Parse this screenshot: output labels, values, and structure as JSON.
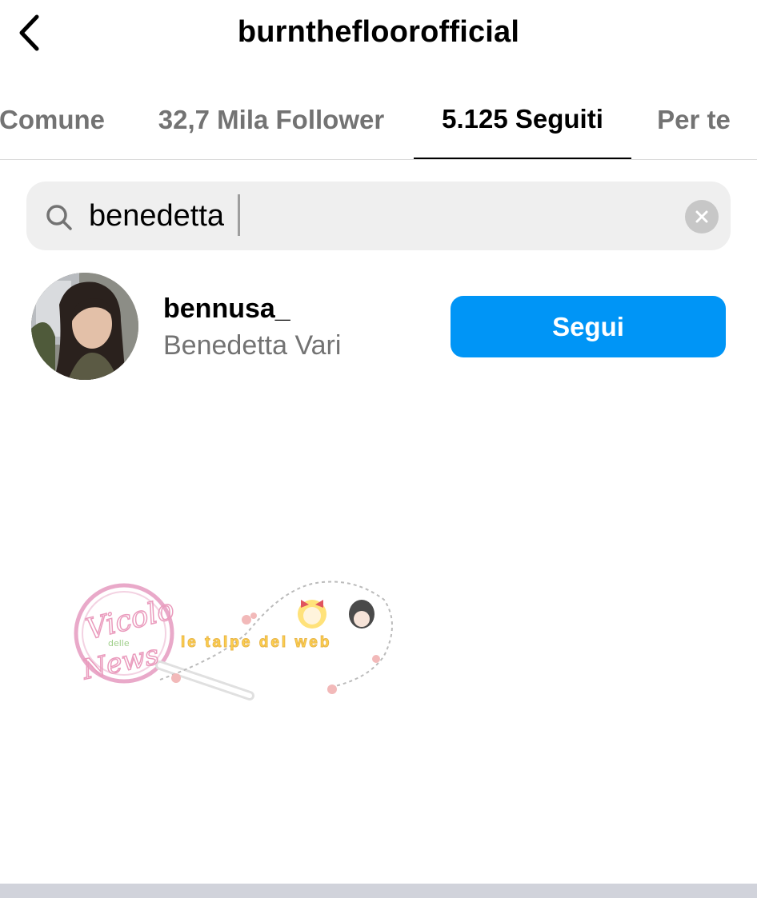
{
  "header": {
    "title": "burnthefloorofficial",
    "back_icon": "chevron-left-icon"
  },
  "tabs": [
    {
      "label": "Comune",
      "active": false
    },
    {
      "label": "32,7 Mila Follower",
      "active": false
    },
    {
      "label": "5.125 Seguiti",
      "active": true
    },
    {
      "label": "Per te",
      "active": false
    }
  ],
  "search": {
    "value": "benedetta",
    "icon": "search-icon",
    "clear_icon": "clear-icon"
  },
  "results": [
    {
      "username": "bennusa_",
      "full_name": "Benedetta Vari",
      "button_label": "Segui"
    }
  ],
  "colors": {
    "accent": "#0095f6",
    "secondary_text": "#737373",
    "search_bg": "#efefef"
  }
}
